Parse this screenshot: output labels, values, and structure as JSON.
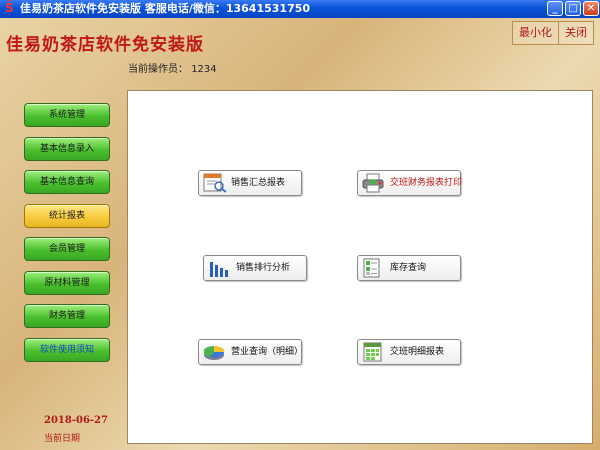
{
  "window": {
    "title": "佳易奶茶店软件免安装版  客服电话/微信：13641531750",
    "minimize_glyph": "_",
    "maximize_glyph": "□",
    "close_glyph": "✕"
  },
  "header": {
    "app_title": "佳易奶茶店软件免安装版",
    "operator_label": "当前操作员：",
    "operator_value": "1234",
    "minimize_label": "最小化",
    "close_label": "关闭"
  },
  "sidebar": {
    "items": [
      {
        "label": "系统管理",
        "active": false
      },
      {
        "label": "基本信息录入",
        "active": false
      },
      {
        "label": "基本信息查询",
        "active": false
      },
      {
        "label": "统计报表",
        "active": true
      },
      {
        "label": "会员管理",
        "active": false
      },
      {
        "label": "原材料管理",
        "active": false
      },
      {
        "label": "财务管理",
        "active": false
      },
      {
        "label": "软件使用须知",
        "active": false
      }
    ],
    "date_value": "2018-06-27",
    "date_label": "当前日期"
  },
  "main": {
    "buttons": [
      {
        "label": "销售汇总报表",
        "icon": "report-search-icon"
      },
      {
        "label": "交班财务报表打印",
        "icon": "print-report-icon"
      },
      {
        "label": "销售排行分析",
        "icon": "bar-chart-icon"
      },
      {
        "label": "库存查询",
        "icon": "inventory-icon"
      },
      {
        "label": "营业查询（明细）",
        "icon": "pie-chart-icon"
      },
      {
        "label": "交班明细报表",
        "icon": "spreadsheet-icon"
      }
    ]
  },
  "colors": {
    "title_red": "#c01818",
    "nav_green": "#4bc02f",
    "nav_active_yellow": "#f7c93a",
    "titlebar_blue": "#0a52d8"
  }
}
